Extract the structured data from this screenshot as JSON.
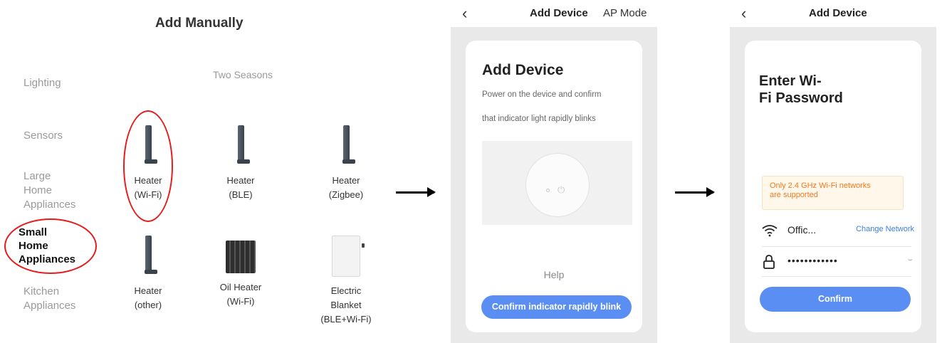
{
  "panel1": {
    "title": "Add Manually",
    "categories": [
      "Lighting",
      "Sensors",
      "Large\nHome\nAppliances",
      "Small\nHome\nAppliances",
      "Kitchen\nAppliances"
    ],
    "section": "Two Seasons",
    "devices": [
      {
        "line1": "Heater",
        "line2": "(Wi-Fi)",
        "line3": "",
        "icon": "tower-heater-icon"
      },
      {
        "line1": "Heater",
        "line2": "(BLE)",
        "line3": "",
        "icon": "tower-heater-icon"
      },
      {
        "line1": "Heater",
        "line2": "(Zigbee)",
        "line3": "",
        "icon": "tower-heater-icon"
      },
      {
        "line1": "Heater",
        "line2": "(other)",
        "line3": "",
        "icon": "tower-heater-icon"
      },
      {
        "line1": "Oil Heater",
        "line2": "(Wi-Fi)",
        "line3": "",
        "icon": "oil-heater-icon"
      },
      {
        "line1": "Electric",
        "line2": "Blanket",
        "line3": "(BLE+Wi-Fi)",
        "icon": "electric-blanket-icon"
      }
    ],
    "highlight_color": "#e51c1c"
  },
  "panel2": {
    "back": "‹",
    "header_title": "Add Device",
    "header_right": "AP Mode",
    "card_title": "Add Device",
    "desc_line1": "Power on the device and confirm",
    "desc_line2": "that indicator light rapidly blinks",
    "help": "Help",
    "button": "Confirm indicator rapidly blink"
  },
  "panel3": {
    "back": "‹",
    "header_title": "Add Device",
    "title_line1": "Enter Wi-",
    "title_line2": "Fi Password",
    "note_line1": "Only 2.4 GHz Wi-Fi networks",
    "note_line2": "are supported",
    "network": "Offic...",
    "change_network": "Change Network",
    "password": "••••••••••••",
    "eye": "⌣",
    "button": "Confirm"
  },
  "colors": {
    "accent": "#5a8ef2",
    "warning": "#f07a20",
    "link": "#3b7de0"
  }
}
